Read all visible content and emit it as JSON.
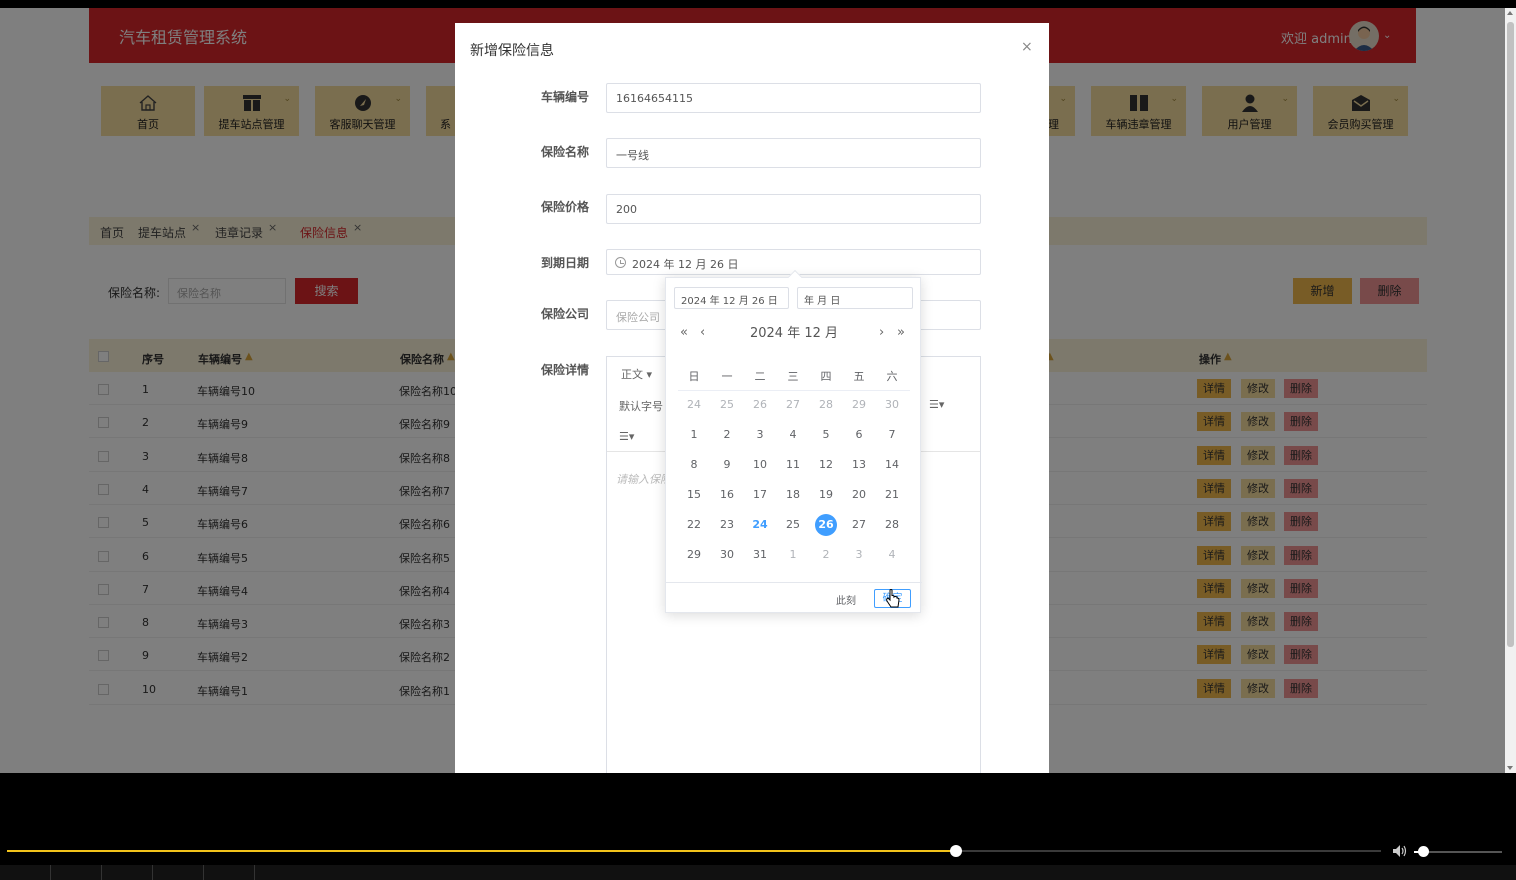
{
  "header": {
    "system_title": "汽车租赁管理系统",
    "welcome": "欢迎 admin"
  },
  "nav": [
    {
      "label": "首页",
      "icon": "home-icon",
      "dropdown": false
    },
    {
      "label": "提车站点管理",
      "icon": "store-icon",
      "dropdown": true
    },
    {
      "label": "客服聊天管理",
      "icon": "chat-icon",
      "dropdown": true
    },
    {
      "label": "系",
      "icon": "system-icon",
      "dropdown": false
    },
    {
      "label": "理",
      "icon": "",
      "dropdown": true
    },
    {
      "label": "车辆违章管理",
      "icon": "columns-icon",
      "dropdown": true
    },
    {
      "label": "用户管理",
      "icon": "user-icon",
      "dropdown": true
    },
    {
      "label": "会员购买管理",
      "icon": "mail-icon",
      "dropdown": true
    }
  ],
  "tabs": [
    {
      "label": "首页",
      "closable": false
    },
    {
      "label": "提车站点",
      "closable": true
    },
    {
      "label": "违章记录",
      "closable": true
    },
    {
      "label": "保险信息",
      "closable": true,
      "active": true
    }
  ],
  "search": {
    "label": "保险名称:",
    "placeholder": "保险名称",
    "button": "搜索"
  },
  "actions": {
    "add": "新增",
    "delete": "删除"
  },
  "table": {
    "headers": [
      "序号",
      "车辆编号",
      "保险名称",
      "操作"
    ],
    "rows": [
      {
        "no": "1",
        "vehicle": "车辆编号10",
        "name": "保险名称10"
      },
      {
        "no": "2",
        "vehicle": "车辆编号9",
        "name": "保险名称9"
      },
      {
        "no": "3",
        "vehicle": "车辆编号8",
        "name": "保险名称8"
      },
      {
        "no": "4",
        "vehicle": "车辆编号7",
        "name": "保险名称7"
      },
      {
        "no": "5",
        "vehicle": "车辆编号6",
        "name": "保险名称6"
      },
      {
        "no": "6",
        "vehicle": "车辆编号5",
        "name": "保险名称5"
      },
      {
        "no": "7",
        "vehicle": "车辆编号4",
        "name": "保险名称4"
      },
      {
        "no": "8",
        "vehicle": "车辆编号3",
        "name": "保险名称3"
      },
      {
        "no": "9",
        "vehicle": "车辆编号2",
        "name": "保险名称2"
      },
      {
        "no": "10",
        "vehicle": "车辆编号1",
        "name": "保险名称1"
      }
    ],
    "row_buttons": {
      "detail": "详情",
      "edit": "修改",
      "delete": "删除"
    }
  },
  "dialog": {
    "title": "新增保险信息",
    "close": "×",
    "fields": {
      "vehicle_no": {
        "label": "车辆编号",
        "value": "16164654115"
      },
      "insurance_name": {
        "label": "保险名称",
        "value": "一号线"
      },
      "price": {
        "label": "保险价格",
        "value": "200"
      },
      "expiry": {
        "label": "到期日期",
        "value": "2024 年 12 月 26 日"
      },
      "company": {
        "label": "保险公司",
        "placeholder": "保险公司"
      },
      "details": {
        "label": "保险详情"
      }
    },
    "editor": {
      "paragraph": "正文",
      "font_size": "默认字号",
      "placeholder": "请输入保险"
    }
  },
  "datepicker": {
    "date_field": "2024 年 12 月 26 日",
    "time_field": "年 月 日",
    "header": "2024 年  12 月",
    "weekdays": [
      "日",
      "一",
      "二",
      "三",
      "四",
      "五",
      "六"
    ],
    "weeks": [
      [
        "24",
        "25",
        "26",
        "27",
        "28",
        "29",
        "30"
      ],
      [
        "1",
        "2",
        "3",
        "4",
        "5",
        "6",
        "7"
      ],
      [
        "8",
        "9",
        "10",
        "11",
        "12",
        "13",
        "14"
      ],
      [
        "15",
        "16",
        "17",
        "18",
        "19",
        "20",
        "21"
      ],
      [
        "22",
        "23",
        "24",
        "25",
        "26",
        "27",
        "28"
      ],
      [
        "29",
        "30",
        "31",
        "1",
        "2",
        "3",
        "4"
      ]
    ],
    "today": "24",
    "selected": "26",
    "now_button": "此刻",
    "ok_button": "确定"
  },
  "player": {
    "progress": 0.691,
    "volume": 0.1
  },
  "colors": {
    "brand_red": "#d8262b",
    "nav_yellow": "#f5dc9e",
    "picker_blue": "#409eff",
    "progress_yellow": "#f2c31b"
  }
}
